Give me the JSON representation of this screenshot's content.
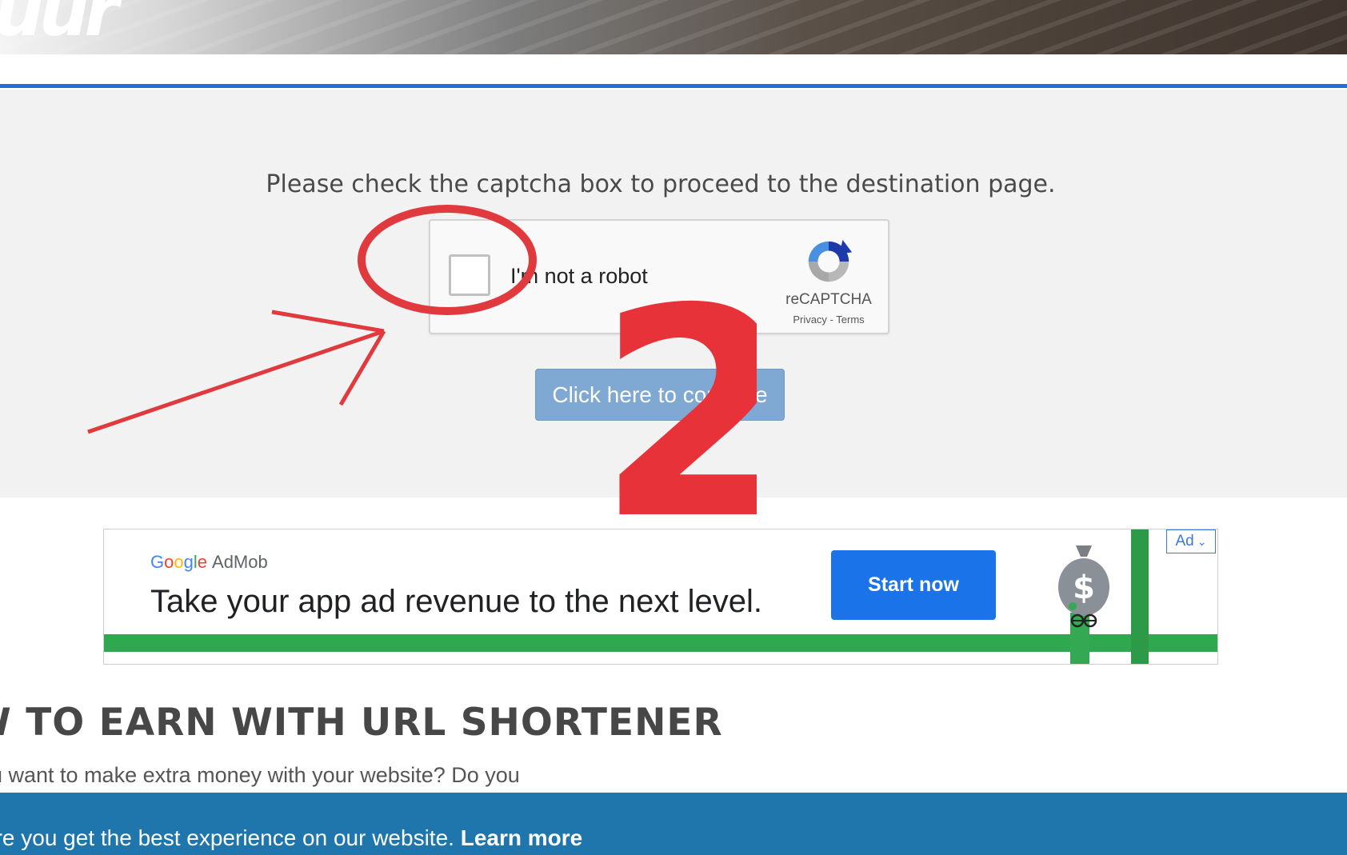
{
  "header": {
    "logo_text": "uur"
  },
  "captcha_page": {
    "instruction": "Please check the captcha box to proceed to the destination page.",
    "recaptcha": {
      "checkbox_label": "I'm not a robot",
      "brand": "reCAPTCHA",
      "privacy": "Privacy",
      "separator": "-",
      "terms": "Terms"
    },
    "continue_label": "Click here to continue"
  },
  "annotation": {
    "step_number": "2",
    "accent_color": "#e8323a"
  },
  "ad": {
    "brand_google": [
      "G",
      "o",
      "o",
      "g",
      "l",
      "e"
    ],
    "brand_product": "AdMob",
    "headline": "Take your app ad revenue to the next level.",
    "cta_label": "Start now",
    "choice_label": "Ad"
  },
  "content": {
    "title": "W TO EARN WITH URL SHORTENER",
    "body": "u want to make extra money with your website? Do you"
  },
  "cookie_notice": {
    "text": "ure you get the best experience on our website.",
    "link_label": "Learn more"
  }
}
